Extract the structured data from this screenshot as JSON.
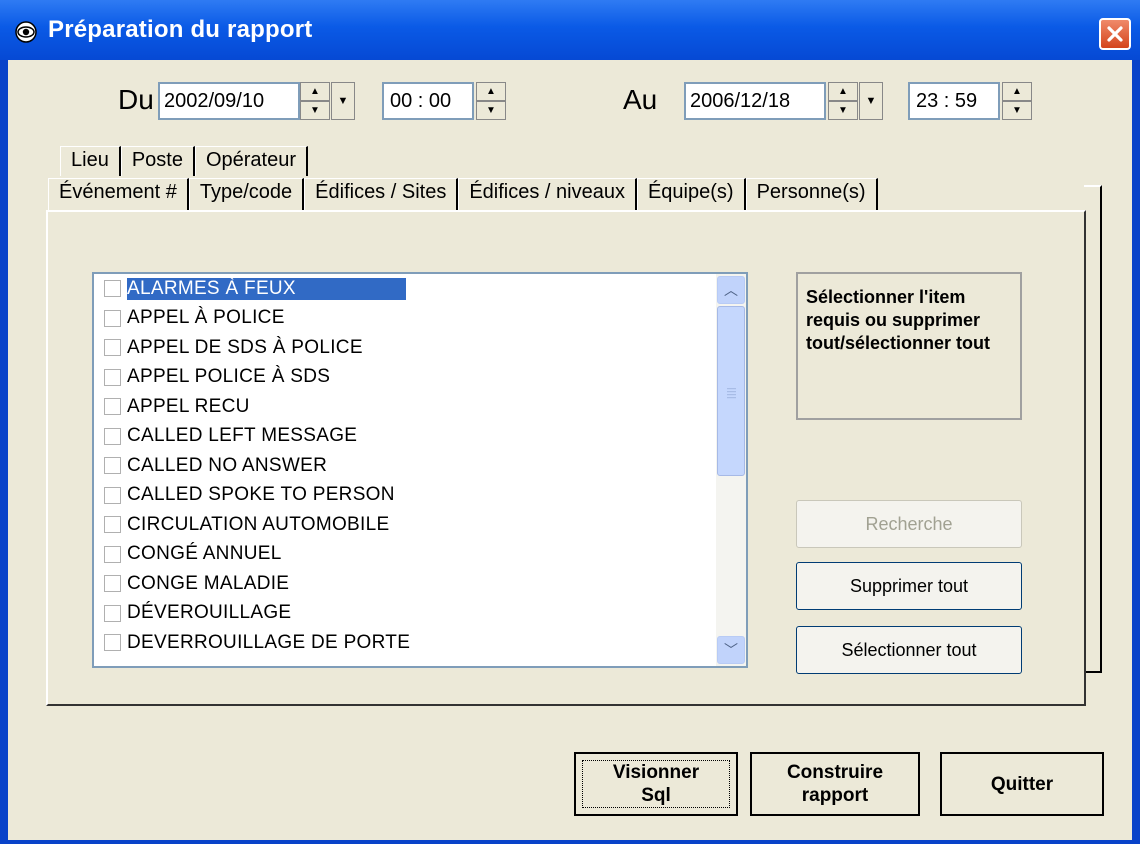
{
  "window": {
    "title": "Préparation du rapport",
    "accent": "#0a5ae6"
  },
  "from": {
    "label": "Du",
    "date": "2002/09/10",
    "time": "00 : 00"
  },
  "to": {
    "label": "Au",
    "date": "2006/12/18",
    "time": "23 : 59"
  },
  "tabs_back": [
    "Lieu",
    "Poste",
    "Opérateur"
  ],
  "tabs_front": [
    "Événement #",
    "Type/code",
    "Édifices / Sites",
    "Édifices / niveaux",
    "Équipe(s)",
    "Personne(s)"
  ],
  "active_tab": "Type/code",
  "list": {
    "items": [
      {
        "label": "ALARMES À FEUX",
        "checked": false,
        "selected": true
      },
      {
        "label": "APPEL À POLICE",
        "checked": false,
        "selected": false
      },
      {
        "label": "APPEL DE SDS À POLICE",
        "checked": false,
        "selected": false
      },
      {
        "label": "APPEL POLICE À SDS",
        "checked": false,
        "selected": false
      },
      {
        "label": "APPEL RECU",
        "checked": false,
        "selected": false
      },
      {
        "label": "CALLED LEFT MESSAGE",
        "checked": false,
        "selected": false
      },
      {
        "label": "CALLED NO ANSWER",
        "checked": false,
        "selected": false
      },
      {
        "label": "CALLED SPOKE TO PERSON",
        "checked": false,
        "selected": false
      },
      {
        "label": "CIRCULATION AUTOMOBILE",
        "checked": false,
        "selected": false
      },
      {
        "label": "CONGÉ ANNUEL",
        "checked": false,
        "selected": false
      },
      {
        "label": "CONGE MALADIE",
        "checked": false,
        "selected": false
      },
      {
        "label": "DÉVEROUILLAGE",
        "checked": false,
        "selected": false
      },
      {
        "label": "DEVERROUILLAGE DE PORTE",
        "checked": false,
        "selected": false
      }
    ]
  },
  "info": {
    "text": "Sélectionner l'item requis ou supprimer tout/sélectionner tout"
  },
  "buttons": {
    "search": "Recherche",
    "clear_all": "Supprimer tout",
    "select_all": "Sélectionner tout",
    "view_sql_line1": "Visionner",
    "view_sql_line2": "Sql",
    "build_line1": "Construire",
    "build_line2": "rapport",
    "quit": "Quitter"
  },
  "icons": {
    "app": "eye-icon",
    "close": "close-icon",
    "spin_up": "arrow-up-icon",
    "spin_down": "arrow-down-icon",
    "dropdown": "chevron-down-icon"
  }
}
